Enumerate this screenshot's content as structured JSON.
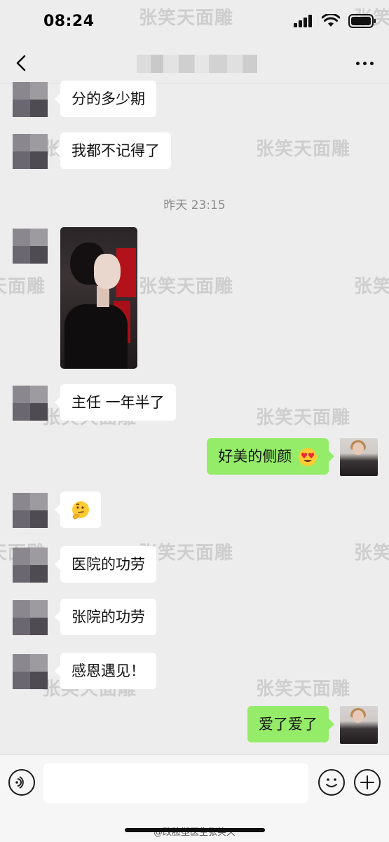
{
  "status": {
    "time": "08:24"
  },
  "nav": {
    "back_icon": "chevron-left-icon",
    "more_icon": "more-dots-icon"
  },
  "messages": [
    {
      "side": "left",
      "text": "分的多少期"
    },
    {
      "side": "left",
      "text": "我都不记得了"
    },
    {
      "side": "left",
      "text": "主任 一年半了"
    },
    {
      "side": "right",
      "text": "好美的侧颜",
      "emoji": "heart-eyes-emoji"
    },
    {
      "side": "left",
      "text": "",
      "emoji": "thinking-face-emoji"
    },
    {
      "side": "left",
      "text": "医院的功劳"
    },
    {
      "side": "left",
      "text": "张院的功劳"
    },
    {
      "side": "left",
      "text": "感恩遇见！"
    },
    {
      "side": "right",
      "text": "爱了爱了"
    }
  ],
  "timestamp": "昨天 23:15",
  "watermark": "张笑天面雕",
  "footer": "@改脸塑医生张笑天",
  "input": {
    "voice_icon": "voice-icon",
    "emoji_icon": "emoji-icon",
    "plus_icon": "plus-icon"
  },
  "colors": {
    "bg": "#ededed",
    "bubble_left": "#ffffff",
    "bubble_right": "#95ec69"
  }
}
